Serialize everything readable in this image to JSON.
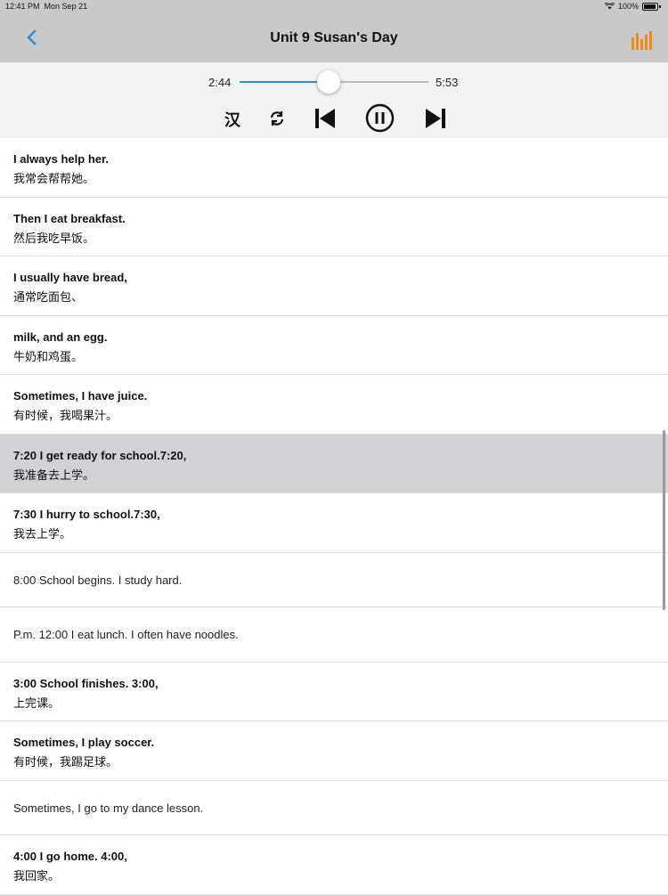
{
  "status": {
    "time": "12:41 PM",
    "date": "Mon Sep 21",
    "battery": "100%"
  },
  "nav": {
    "title": "Unit 9 Susan's Day",
    "back_icon": "chevron-left-icon",
    "menu_icon": "equalizer-icon",
    "accent": "#2a8fd8",
    "icon_orange": "#f08a1d"
  },
  "player": {
    "current_time": "2:44",
    "duration": "5:53",
    "progress": 0.47,
    "translate_label": "汉"
  },
  "sentences": [
    {
      "en": "I always help her.",
      "zh": "我常会帮帮她。"
    },
    {
      "en": "Then I eat breakfast.",
      "zh": "然后我吃早饭。"
    },
    {
      "en": "I usually have bread,",
      "zh": "通常吃面包、"
    },
    {
      "en": "milk, and an egg.",
      "zh": "牛奶和鸡蛋。"
    },
    {
      "en": "Sometimes, I have juice.",
      "zh": "有时候，我喝果汁。"
    },
    {
      "en": "7:20 I get ready for school.7:20,",
      "zh": "我准备去上学。",
      "selected": true
    },
    {
      "en": "7:30 I hurry to school.7:30,",
      "zh": "我去上学。"
    },
    {
      "en": "8:00 School begins. I study hard.",
      "zh": ""
    },
    {
      "en": "P.m. 12:00 I eat lunch. I often have noodles.",
      "zh": ""
    },
    {
      "en": "3:00 School finishes. 3:00,",
      "zh": "上完课。"
    },
    {
      "en": "Sometimes, I play soccer.",
      "zh": "有时候，我踢足球。"
    },
    {
      "en": "Sometimes, I go to my dance lesson.",
      "zh": ""
    },
    {
      "en": "4:00 I go home. 4:00,",
      "zh": "我回家。"
    }
  ]
}
